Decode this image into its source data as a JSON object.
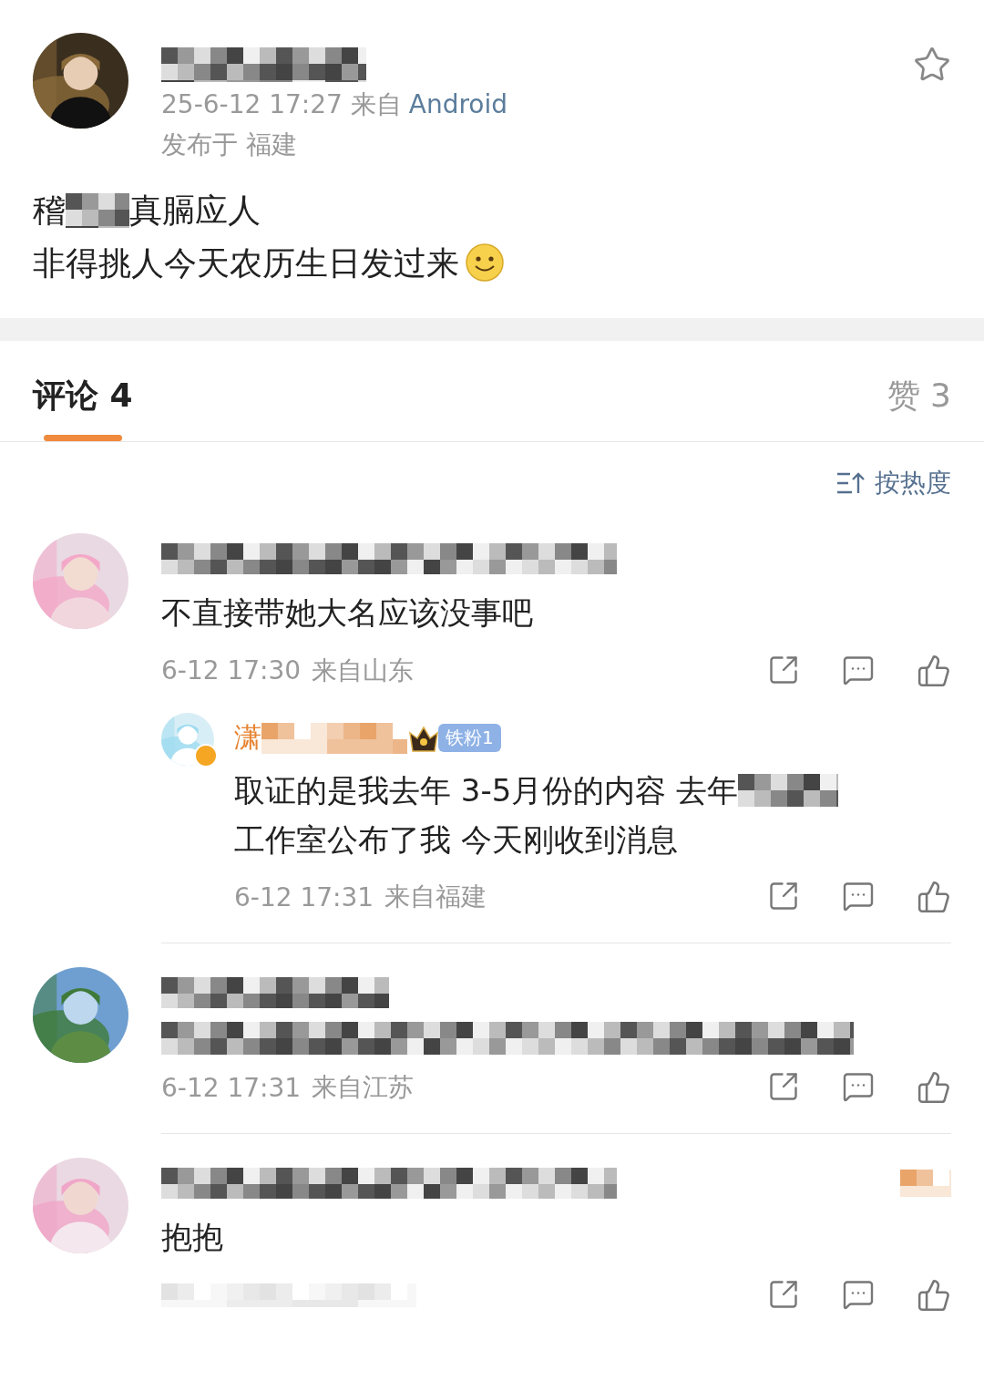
{
  "post": {
    "avatar": {
      "kind": "picture"
    },
    "name": [
      {
        "kind": "mosaic"
      }
    ],
    "time": "25-6-12 17:27",
    "source_label": "来自",
    "source": "Android",
    "location": "发布于 福建",
    "starred": false,
    "lines": [
      [
        {
          "kind": "text",
          "text": "稽"
        },
        {
          "kind": "mosaic"
        },
        {
          "kind": "text",
          "text": "真膈应人"
        }
      ],
      [
        {
          "kind": "text",
          "text": "非得挑人今天农历生日发过来"
        },
        {
          "kind": "emoji"
        }
      ]
    ]
  },
  "tabs": [
    {
      "label": "评论 4",
      "selected": true
    },
    {
      "label": "赞 3",
      "selected": false
    }
  ],
  "sort": "按热度",
  "comments": [
    {
      "avatar": {
        "kind": "picture"
      },
      "name": [
        {
          "kind": "mosaic"
        }
      ],
      "lines": [
        [
          {
            "kind": "text",
            "text": "不直接带她大名应该没事吧"
          }
        ]
      ],
      "meta": [
        {
          "kind": "text",
          "text": "6-12 17:30"
        },
        {
          "kind": "text",
          "text": "来自山东"
        }
      ],
      "replies": [
        {
          "avatar": {
            "kind": "picture"
          },
          "verified": true,
          "name": [
            {
              "kind": "text",
              "text": "潇"
            },
            {
              "kind": "mosaic",
              "color": "#e9a46a"
            }
          ],
          "badge": "铁粉1",
          "lines": [
            [
              {
                "kind": "text",
                "text": "取证的是我去年 3-5月份的内容 去年"
              },
              {
                "kind": "mosaic"
              }
            ],
            [
              {
                "kind": "text",
                "text": "工作室公布了我 今天刚收到消息"
              }
            ]
          ],
          "meta": [
            {
              "kind": "text",
              "text": "6-12 17:31"
            },
            {
              "kind": "text",
              "text": "来自福建"
            }
          ]
        }
      ]
    },
    {
      "avatar": {
        "kind": "picture"
      },
      "name": [
        {
          "kind": "mosaic"
        }
      ],
      "lines": [
        [
          {
            "kind": "mosaic"
          }
        ]
      ],
      "meta": [
        {
          "kind": "text",
          "text": "6-12 17:31"
        },
        {
          "kind": "text",
          "text": "来自江苏"
        }
      ]
    },
    {
      "avatar": {
        "kind": "picture"
      },
      "name": [
        {
          "kind": "mosaic"
        }
      ],
      "corner": [
        {
          "kind": "mosaic",
          "color": "#e9a46a"
        }
      ],
      "lines": [
        [
          {
            "kind": "text",
            "text": "抱抱"
          }
        ]
      ],
      "meta": [
        {
          "kind": "mosaic",
          "color": "#e2e2e2"
        }
      ]
    }
  ]
}
